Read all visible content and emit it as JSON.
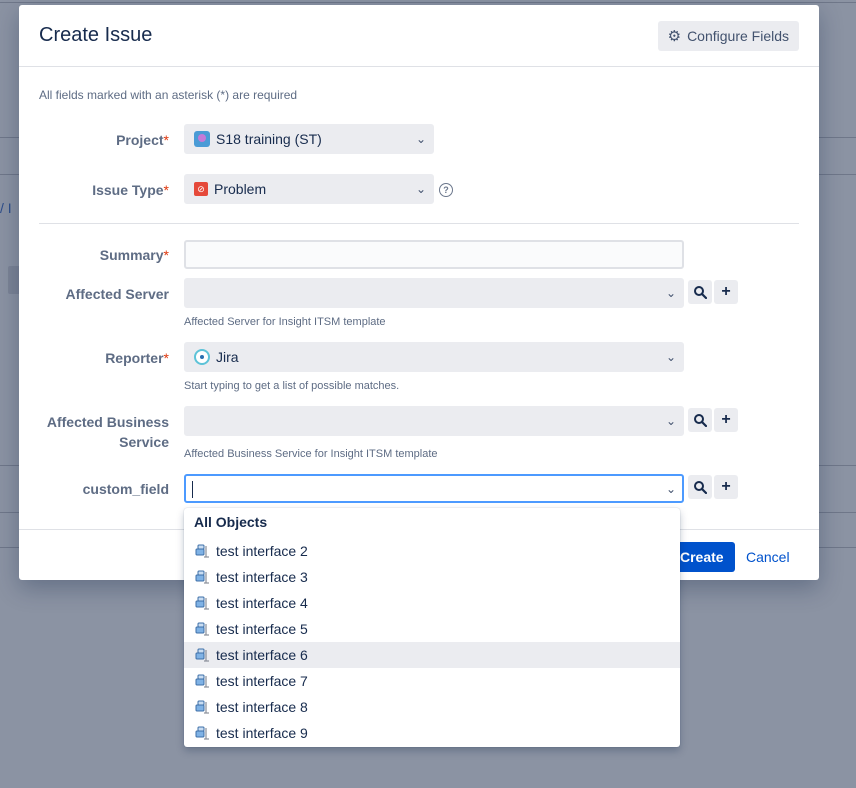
{
  "dialog": {
    "title": "Create Issue",
    "configure_label": "Configure Fields",
    "required_note": "All fields marked with an asterisk (*) are required"
  },
  "fields": {
    "project": {
      "label": "Project",
      "value": "S18 training (ST)"
    },
    "issue_type": {
      "label": "Issue Type",
      "value": "Problem"
    },
    "summary": {
      "label": "Summary",
      "value": ""
    },
    "affected_server": {
      "label": "Affected Server",
      "value": "",
      "description": "Affected Server for Insight ITSM template"
    },
    "reporter": {
      "label": "Reporter",
      "value": "Jira",
      "description": "Start typing to get a list of possible matches."
    },
    "affected_business_service": {
      "label_line1": "Affected Business",
      "label_line2": "Service",
      "value": "",
      "description": "Affected Business Service for Insight ITSM template"
    },
    "custom_field": {
      "label": "custom_field",
      "value": ""
    }
  },
  "required_mark": "*",
  "dropdown": {
    "heading": "All Objects",
    "items": [
      "test interface 2",
      "test interface 3",
      "test interface 4",
      "test interface 5",
      "test interface 6",
      "test interface 7",
      "test interface 8",
      "test interface 9"
    ],
    "highlighted_index": 4
  },
  "footer": {
    "create_label": "Create",
    "cancel_label": "Cancel"
  },
  "background": {
    "crumb": "/  I"
  },
  "icons": {
    "configure": "gear-icon",
    "chevron": "chevron-down-icon",
    "search": "search-icon",
    "add": "plus-icon",
    "help": "help-icon",
    "project": "project-avatar-icon",
    "problem": "problem-issue-type-icon",
    "user": "user-avatar-icon",
    "object": "insight-object-icon"
  },
  "colors": {
    "primary": "#0052cc",
    "required": "#de350b",
    "focus_border": "#4c9aff",
    "overlay": "#8b93a3"
  }
}
